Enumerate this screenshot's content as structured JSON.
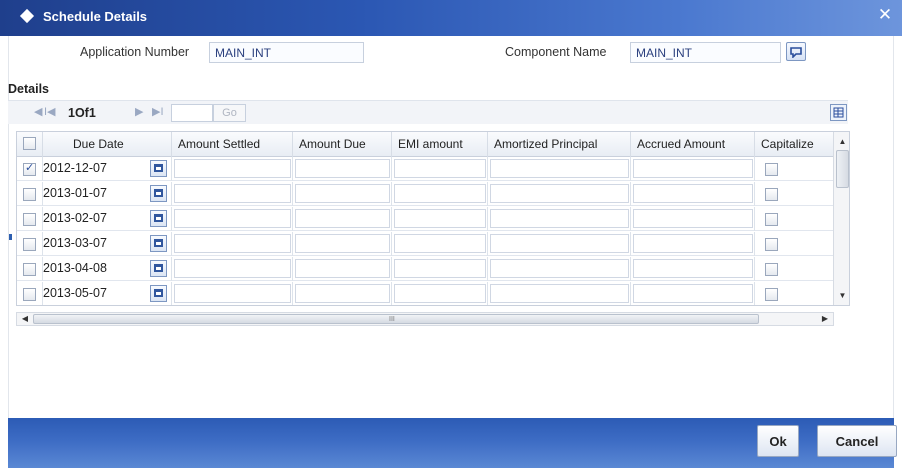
{
  "window": {
    "title": "Schedule Details",
    "close_glyph": "✕"
  },
  "form": {
    "application_number_label": "Application Number",
    "application_number_value": "MAIN_INT",
    "component_name_label": "Component Name",
    "component_name_value": "MAIN_INT"
  },
  "details": {
    "section_label": "Details",
    "pager": {
      "first_glyph": "I◀",
      "prev_glyph": "◀",
      "count_text": "1Of1",
      "next_glyph": "▶",
      "last_glyph": "▶I",
      "go_label": "Go",
      "page_input_value": ""
    },
    "columns": [
      "Due Date",
      "Amount Settled",
      "Amount Due",
      "EMI amount",
      "Amortized Principal",
      "Accrued Amount",
      "Capitalize"
    ],
    "rows": [
      {
        "selected": true,
        "due_date": "2012-12-07",
        "capitalize": false
      },
      {
        "selected": false,
        "due_date": "2013-01-07",
        "capitalize": false
      },
      {
        "selected": false,
        "due_date": "2013-02-07",
        "capitalize": false
      },
      {
        "selected": false,
        "due_date": "2013-03-07",
        "capitalize": false
      },
      {
        "selected": false,
        "due_date": "2013-04-08",
        "capitalize": false
      },
      {
        "selected": false,
        "due_date": "2013-05-07",
        "capitalize": false
      }
    ],
    "hscroll_grip": "III",
    "vscroll_up": "▲",
    "vscroll_down": "▼",
    "hscroll_left": "◀",
    "hscroll_right": "▶"
  },
  "footer": {
    "ok_label": "Ok",
    "cancel_label": "Cancel"
  },
  "icons": {
    "title": "diamond-icon",
    "close": "close-icon",
    "lov": "list-of-values-icon",
    "calendar": "calendar-icon",
    "pager_menu": "column-menu-icon"
  },
  "colors": {
    "titlebar": "#2b57b3",
    "footer": "#3d6cc4",
    "accent_text": "#2a3f7e"
  }
}
